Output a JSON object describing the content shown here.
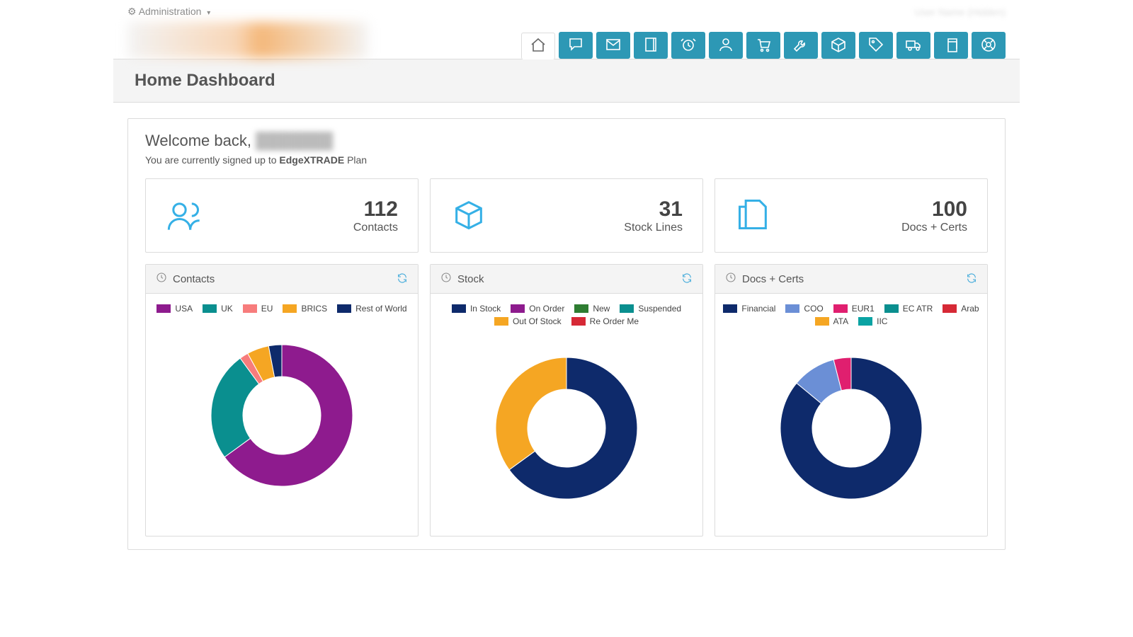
{
  "top": {
    "admin_label": "Administration",
    "user_label": "User Name (Hidden)"
  },
  "page_title": "Home Dashboard",
  "welcome": {
    "prefix": "Welcome back, ",
    "name_masked": "███████",
    "plan_prefix": "You are currently signed up to ",
    "plan_name": "EdgeXTRADE",
    "plan_suffix": " Plan"
  },
  "stats": [
    {
      "icon": "users",
      "value": "112",
      "label": "Contacts"
    },
    {
      "icon": "cube",
      "value": "31",
      "label": "Stock Lines"
    },
    {
      "icon": "docs",
      "value": "100",
      "label": "Docs + Certs"
    }
  ],
  "nav_icons": [
    "home",
    "chat",
    "mail",
    "book",
    "alarm",
    "user",
    "cart",
    "wrench",
    "box",
    "tag",
    "truck",
    "copy",
    "help"
  ],
  "colors": {
    "purple": "#8e1b8e",
    "teal": "#0a8f8f",
    "coral": "#f77c7c",
    "orange": "#f5a623",
    "navy": "#0e2a6b",
    "green": "#2e7d32",
    "red": "#d62936",
    "blue": "#6b8fd6",
    "magenta": "#e01f6f",
    "teal2": "#0aa3a3"
  },
  "chart_data": [
    {
      "type": "donut",
      "title": "Contacts",
      "series": [
        {
          "name": "USA",
          "value": 65,
          "color": "purple"
        },
        {
          "name": "UK",
          "value": 25,
          "color": "teal"
        },
        {
          "name": "EU",
          "value": 2,
          "color": "coral"
        },
        {
          "name": "BRICS",
          "value": 5,
          "color": "orange"
        },
        {
          "name": "Rest of World",
          "value": 3,
          "color": "navy"
        }
      ]
    },
    {
      "type": "donut",
      "title": "Stock",
      "series": [
        {
          "name": "In Stock",
          "value": 65,
          "color": "navy"
        },
        {
          "name": "On Order",
          "value": 0,
          "color": "purple"
        },
        {
          "name": "New",
          "value": 0,
          "color": "green"
        },
        {
          "name": "Suspended",
          "value": 0,
          "color": "teal"
        },
        {
          "name": "Out Of Stock",
          "value": 35,
          "color": "orange"
        },
        {
          "name": "Re Order Me",
          "value": 0,
          "color": "red"
        }
      ]
    },
    {
      "type": "donut",
      "title": "Docs + Certs",
      "series": [
        {
          "name": "Financial",
          "value": 86,
          "color": "navy"
        },
        {
          "name": "COO",
          "value": 10,
          "color": "blue"
        },
        {
          "name": "EUR1",
          "value": 4,
          "color": "magenta"
        },
        {
          "name": "EC ATR",
          "value": 0,
          "color": "teal"
        },
        {
          "name": "Arab",
          "value": 0,
          "color": "red"
        },
        {
          "name": "ATA",
          "value": 0,
          "color": "orange"
        },
        {
          "name": "IIC",
          "value": 0,
          "color": "teal2"
        }
      ]
    }
  ]
}
